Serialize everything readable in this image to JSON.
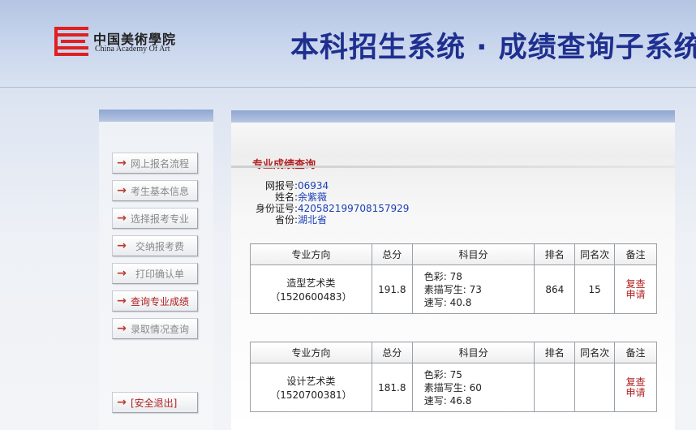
{
  "header": {
    "logo_cn": "中国美術學院",
    "logo_en": "China Academy Of Art",
    "title": "本科招生系统 · 成绩查询子系统"
  },
  "sidebar": {
    "items": [
      {
        "label": "网上报名流程",
        "active": false
      },
      {
        "label": "考生基本信息",
        "active": false
      },
      {
        "label": "选择报考专业",
        "active": false
      },
      {
        "label": "交纳报考费",
        "active": false
      },
      {
        "label": "打印确认单",
        "active": false
      },
      {
        "label": "查询专业成绩",
        "active": true
      },
      {
        "label": "录取情况查询",
        "active": false
      }
    ],
    "logout": "[安全退出]",
    "arrow": "→"
  },
  "main": {
    "section_title": "专业成绩查询",
    "info": {
      "reg_no_label": "网报号:",
      "reg_no": "06934",
      "name_label": "姓名:",
      "name": "余紫薇",
      "id_label": "身份证号:",
      "id": "420582199708157929",
      "province_label": "省份:",
      "province": "湖北省"
    },
    "table_headers": {
      "direction": "专业方向",
      "total": "总分",
      "subjects": "科目分",
      "rank": "排名",
      "same_rank": "同名次",
      "note": "备注"
    },
    "results": [
      {
        "direction": "造型艺术类",
        "code": "（1520600483）",
        "total": "191.8",
        "subjects": [
          "色彩: 78",
          "素描写生: 73",
          "速写: 40.8"
        ],
        "rank": "864",
        "same_rank": "15",
        "recheck_1": "复查",
        "recheck_2": "申请"
      },
      {
        "direction": "设计艺术类",
        "code": "（1520700381）",
        "total": "181.8",
        "subjects": [
          "色彩: 75",
          "素描写生: 60",
          "速写: 46.8"
        ],
        "rank": "",
        "same_rank": "",
        "recheck_1": "复查",
        "recheck_2": "申请"
      }
    ]
  },
  "colors": {
    "title_blue": "#1f2f8f",
    "accent_red": "#b22222",
    "link_blue": "#1a3fb5",
    "logo_red": "#e02020"
  }
}
